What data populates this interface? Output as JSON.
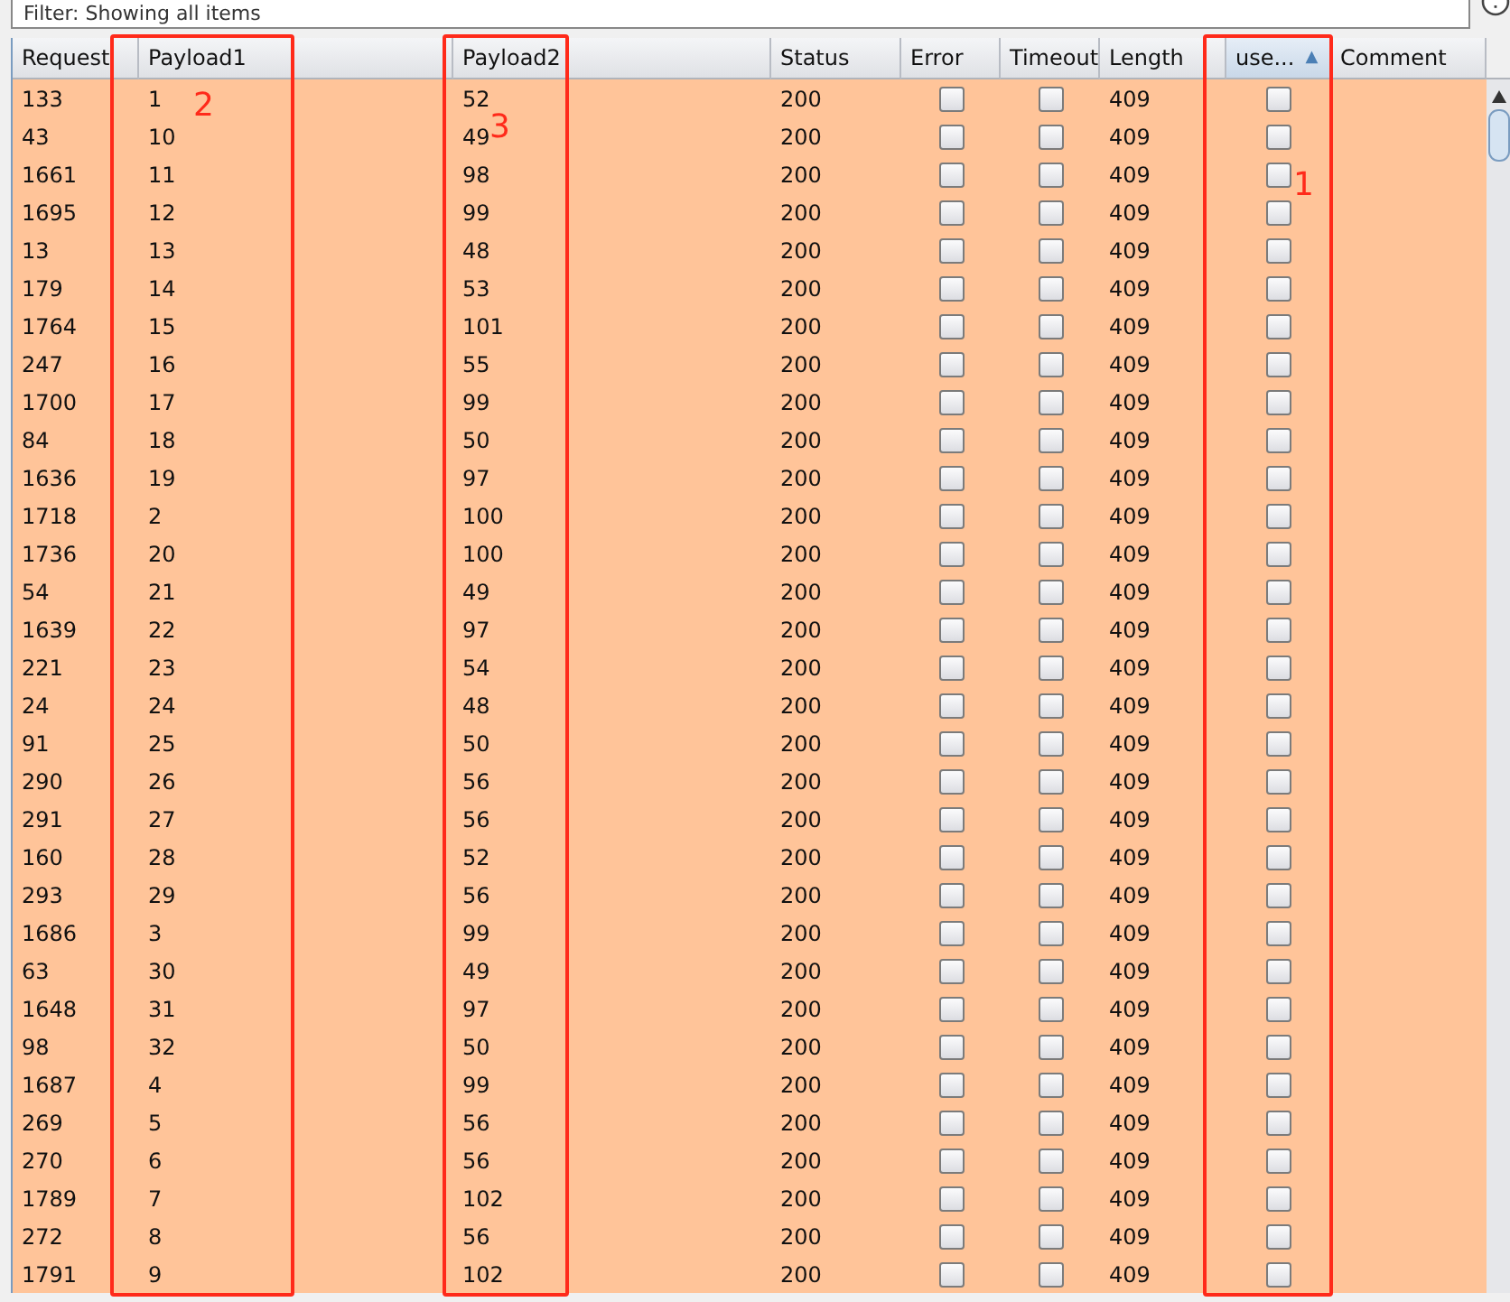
{
  "filter": {
    "text": "Filter: Showing all items"
  },
  "table": {
    "columns": [
      {
        "label": "Request",
        "sorted": false
      },
      {
        "label": "Payload1",
        "sorted": false
      },
      {
        "label": "Payload2",
        "sorted": false
      },
      {
        "label": "Status",
        "sorted": false
      },
      {
        "label": "Error",
        "sorted": false
      },
      {
        "label": "Timeout",
        "sorted": false
      },
      {
        "label": "Length",
        "sorted": false
      },
      {
        "label": "use...",
        "sorted": true,
        "sort_indicator": "▲"
      },
      {
        "label": "Comment",
        "sorted": false
      }
    ],
    "rows": [
      {
        "request": "133",
        "payload1": "1",
        "payload2": "52",
        "status": "200",
        "error": false,
        "timeout": false,
        "length": "409",
        "use": false
      },
      {
        "request": "43",
        "payload1": "10",
        "payload2": "49",
        "status": "200",
        "error": false,
        "timeout": false,
        "length": "409",
        "use": false
      },
      {
        "request": "1661",
        "payload1": "11",
        "payload2": "98",
        "status": "200",
        "error": false,
        "timeout": false,
        "length": "409",
        "use": false
      },
      {
        "request": "1695",
        "payload1": "12",
        "payload2": "99",
        "status": "200",
        "error": false,
        "timeout": false,
        "length": "409",
        "use": false
      },
      {
        "request": "13",
        "payload1": "13",
        "payload2": "48",
        "status": "200",
        "error": false,
        "timeout": false,
        "length": "409",
        "use": false
      },
      {
        "request": "179",
        "payload1": "14",
        "payload2": "53",
        "status": "200",
        "error": false,
        "timeout": false,
        "length": "409",
        "use": false
      },
      {
        "request": "1764",
        "payload1": "15",
        "payload2": "101",
        "status": "200",
        "error": false,
        "timeout": false,
        "length": "409",
        "use": false
      },
      {
        "request": "247",
        "payload1": "16",
        "payload2": "55",
        "status": "200",
        "error": false,
        "timeout": false,
        "length": "409",
        "use": false
      },
      {
        "request": "1700",
        "payload1": "17",
        "payload2": "99",
        "status": "200",
        "error": false,
        "timeout": false,
        "length": "409",
        "use": false
      },
      {
        "request": "84",
        "payload1": "18",
        "payload2": "50",
        "status": "200",
        "error": false,
        "timeout": false,
        "length": "409",
        "use": false
      },
      {
        "request": "1636",
        "payload1": "19",
        "payload2": "97",
        "status": "200",
        "error": false,
        "timeout": false,
        "length": "409",
        "use": false
      },
      {
        "request": "1718",
        "payload1": "2",
        "payload2": "100",
        "status": "200",
        "error": false,
        "timeout": false,
        "length": "409",
        "use": false
      },
      {
        "request": "1736",
        "payload1": "20",
        "payload2": "100",
        "status": "200",
        "error": false,
        "timeout": false,
        "length": "409",
        "use": false
      },
      {
        "request": "54",
        "payload1": "21",
        "payload2": "49",
        "status": "200",
        "error": false,
        "timeout": false,
        "length": "409",
        "use": false
      },
      {
        "request": "1639",
        "payload1": "22",
        "payload2": "97",
        "status": "200",
        "error": false,
        "timeout": false,
        "length": "409",
        "use": false
      },
      {
        "request": "221",
        "payload1": "23",
        "payload2": "54",
        "status": "200",
        "error": false,
        "timeout": false,
        "length": "409",
        "use": false
      },
      {
        "request": "24",
        "payload1": "24",
        "payload2": "48",
        "status": "200",
        "error": false,
        "timeout": false,
        "length": "409",
        "use": false
      },
      {
        "request": "91",
        "payload1": "25",
        "payload2": "50",
        "status": "200",
        "error": false,
        "timeout": false,
        "length": "409",
        "use": false
      },
      {
        "request": "290",
        "payload1": "26",
        "payload2": "56",
        "status": "200",
        "error": false,
        "timeout": false,
        "length": "409",
        "use": false
      },
      {
        "request": "291",
        "payload1": "27",
        "payload2": "56",
        "status": "200",
        "error": false,
        "timeout": false,
        "length": "409",
        "use": false
      },
      {
        "request": "160",
        "payload1": "28",
        "payload2": "52",
        "status": "200",
        "error": false,
        "timeout": false,
        "length": "409",
        "use": false
      },
      {
        "request": "293",
        "payload1": "29",
        "payload2": "56",
        "status": "200",
        "error": false,
        "timeout": false,
        "length": "409",
        "use": false
      },
      {
        "request": "1686",
        "payload1": "3",
        "payload2": "99",
        "status": "200",
        "error": false,
        "timeout": false,
        "length": "409",
        "use": false
      },
      {
        "request": "63",
        "payload1": "30",
        "payload2": "49",
        "status": "200",
        "error": false,
        "timeout": false,
        "length": "409",
        "use": false
      },
      {
        "request": "1648",
        "payload1": "31",
        "payload2": "97",
        "status": "200",
        "error": false,
        "timeout": false,
        "length": "409",
        "use": false
      },
      {
        "request": "98",
        "payload1": "32",
        "payload2": "50",
        "status": "200",
        "error": false,
        "timeout": false,
        "length": "409",
        "use": false
      },
      {
        "request": "1687",
        "payload1": "4",
        "payload2": "99",
        "status": "200",
        "error": false,
        "timeout": false,
        "length": "409",
        "use": false
      },
      {
        "request": "269",
        "payload1": "5",
        "payload2": "56",
        "status": "200",
        "error": false,
        "timeout": false,
        "length": "409",
        "use": false
      },
      {
        "request": "270",
        "payload1": "6",
        "payload2": "56",
        "status": "200",
        "error": false,
        "timeout": false,
        "length": "409",
        "use": false
      },
      {
        "request": "1789",
        "payload1": "7",
        "payload2": "102",
        "status": "200",
        "error": false,
        "timeout": false,
        "length": "409",
        "use": false
      },
      {
        "request": "272",
        "payload1": "8",
        "payload2": "56",
        "status": "200",
        "error": false,
        "timeout": false,
        "length": "409",
        "use": false
      },
      {
        "request": "1791",
        "payload1": "9",
        "payload2": "102",
        "status": "200",
        "error": false,
        "timeout": false,
        "length": "409",
        "use": false
      }
    ]
  },
  "annotations": [
    {
      "label": "2"
    },
    {
      "label": "3"
    },
    {
      "label": "1"
    }
  ]
}
